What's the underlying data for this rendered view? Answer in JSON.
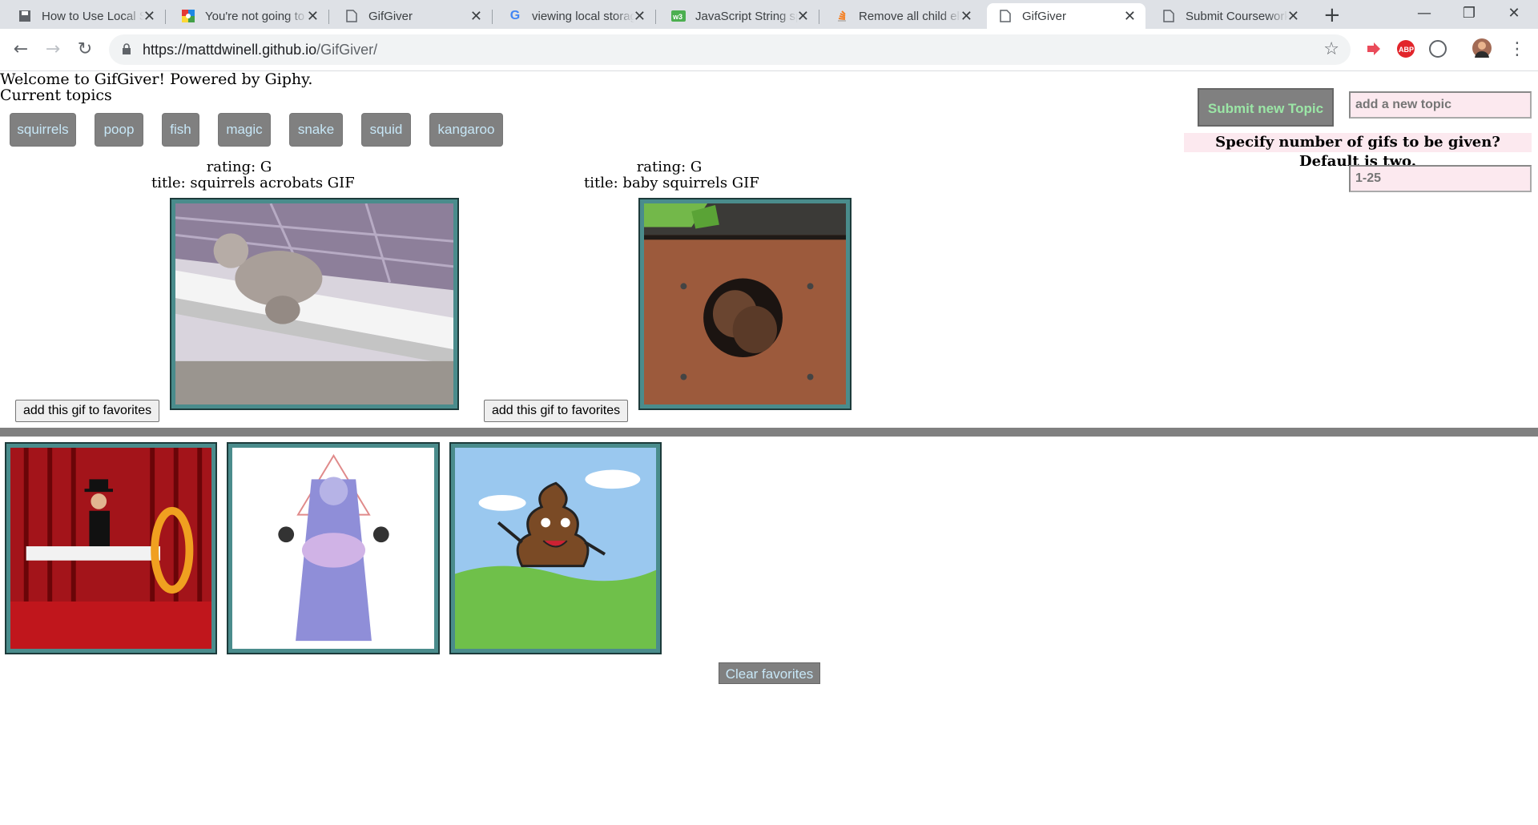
{
  "browser": {
    "tabs": [
      {
        "title": "How to Use Local Storage",
        "icon": "save-icon",
        "active": false
      },
      {
        "title": "You're not going to",
        "icon": "pinwheel-icon",
        "active": false
      },
      {
        "title": "GifGiver",
        "icon": "page-icon",
        "active": false
      },
      {
        "title": "viewing local storage",
        "icon": "google-icon",
        "active": false
      },
      {
        "title": "JavaScript String split",
        "icon": "w3-icon",
        "active": false
      },
      {
        "title": "Remove all child elements",
        "icon": "stack-icon",
        "active": false
      },
      {
        "title": "GifGiver",
        "icon": "page-icon",
        "active": true
      },
      {
        "title": "Submit Coursework",
        "icon": "page-icon",
        "active": false
      }
    ],
    "url_host": "https://mattdwinell.github.io",
    "url_path": "/GifGiver/",
    "extensions": [
      "red-arrow-icon",
      "abp-icon",
      "circle-ext-icon",
      "avatar"
    ],
    "abp_label": "ABP"
  },
  "page": {
    "welcome": "Welcome to GifGiver! Powered by Giphy.",
    "current_topics_label": "Current topics",
    "topics": [
      "squirrels",
      "poop",
      "fish",
      "magic",
      "snake",
      "squid",
      "kangaroo"
    ],
    "submit_label": "Submit new Topic",
    "topic_placeholder": "add a new topic",
    "specify_label": "Specify number of gifs to be given? Default is two.",
    "count_placeholder": "1-25",
    "results": [
      {
        "rating": "rating: G",
        "title": "title: squirrels acrobats GIF",
        "button": "add this gif to favorites"
      },
      {
        "rating": "rating: G",
        "title": "title: baby squirrels GIF",
        "button": "add this gif to favorites"
      }
    ],
    "favorites": [
      {
        "subject": "magician levitation act"
      },
      {
        "subject": "meditating cloaked figure"
      },
      {
        "subject": "dancing poop cartoon"
      }
    ],
    "clear_label": "Clear favorites"
  },
  "colors": {
    "button_gray": "#808080",
    "topic_text": "#c7e7f7",
    "submit_text": "#9be6a6",
    "input_bg": "#fce9ef",
    "gif_border": "#4a8c8c"
  }
}
